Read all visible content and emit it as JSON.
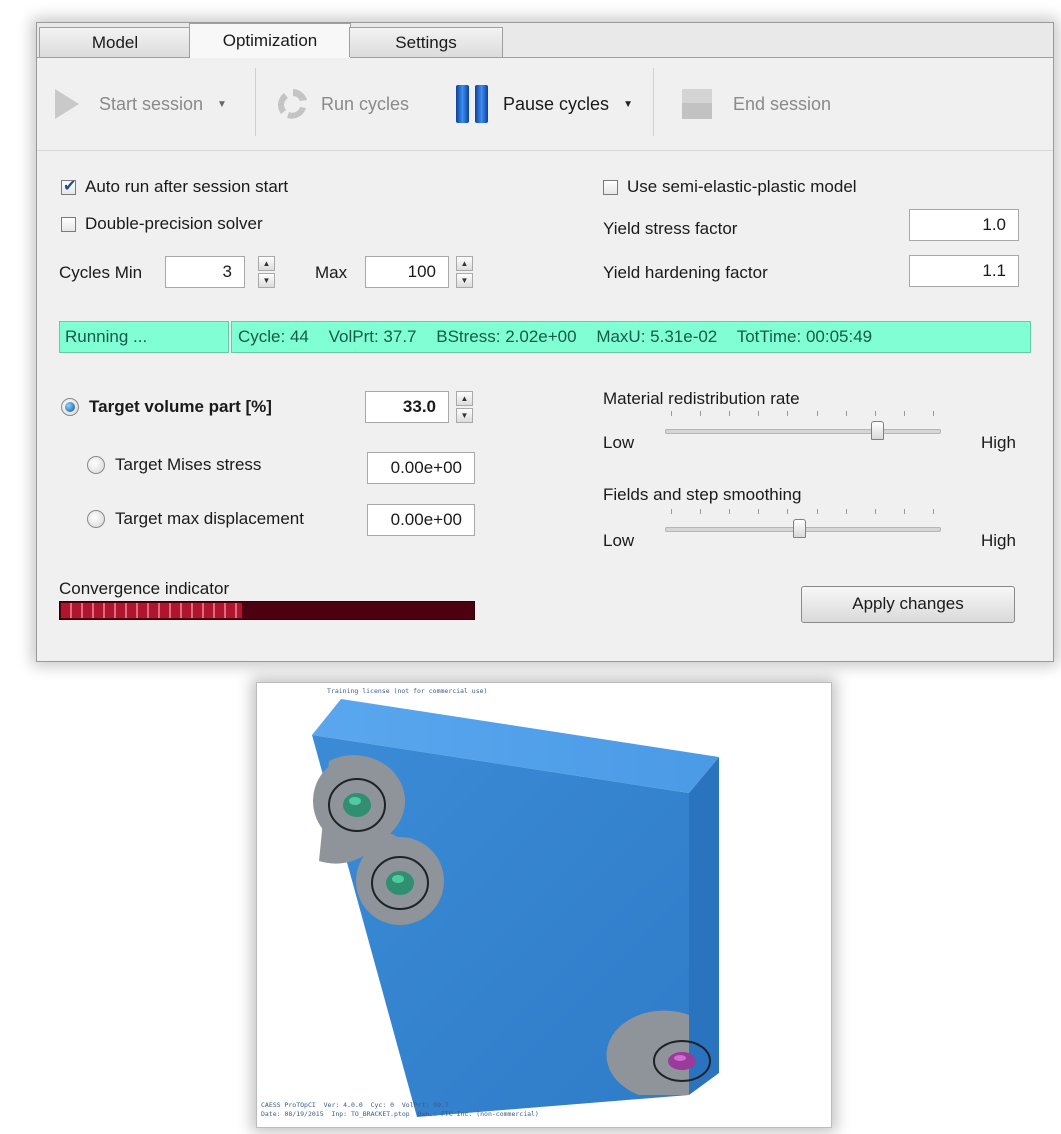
{
  "tabs": [
    "Model",
    "Optimization",
    "Settings"
  ],
  "toolbar": {
    "start_session": "Start session",
    "run_cycles": "Run cycles",
    "pause_cycles": "Pause cycles",
    "end_session": "End session"
  },
  "options": {
    "auto_run": {
      "label": "Auto run after session start",
      "checked": true
    },
    "double_precision": {
      "label": "Double-precision solver",
      "checked": false
    },
    "semi_elastic": {
      "label": "Use semi-elastic-plastic model",
      "checked": false
    }
  },
  "cycles": {
    "min_label": "Cycles Min",
    "min_value": "3",
    "max_label": "Max",
    "max_value": "100"
  },
  "yield": {
    "stress_label": "Yield stress factor",
    "stress_value": "1.0",
    "hardening_label": "Yield hardening factor",
    "hardening_value": "1.1"
  },
  "status": {
    "state": "Running ...",
    "cycle": "Cycle: 44",
    "volprt": "VolPrt: 37.7",
    "bstress": "BStress: 2.02e+00",
    "maxu": "MaxU: 5.31e-02",
    "tottime": "TotTime: 00:05:49"
  },
  "targets": {
    "volume": {
      "label": "Target volume part [%]",
      "value": "33.0",
      "selected": true
    },
    "mises": {
      "label": "Target Mises stress",
      "value": "0.00e+00",
      "selected": false
    },
    "displacement": {
      "label": "Target max displacement",
      "value": "0.00e+00",
      "selected": false
    }
  },
  "sliders": {
    "redistribution": {
      "label": "Material redistribution rate",
      "low": "Low",
      "high": "High",
      "level": 0.79
    },
    "smoothing": {
      "label": "Fields and step smoothing",
      "low": "Low",
      "high": "High",
      "level": 0.49
    }
  },
  "convergence": {
    "label": "Convergence indicator",
    "level": 0.44
  },
  "apply_label": "Apply changes",
  "viewport": {
    "license_text": "Training license (not for commercial use)",
    "footer_line1": "CAESS ProTOpCI  Ver: 4.0.0  Cyc: 0  VolPrt: 99.7",
    "footer_line2": "Date: 08/19/2015  Inp: TO_BRACKET.ptop  Own.: FTC Inc. (non-commercial)"
  },
  "colors": {
    "status_bg": "#80ffd4",
    "part_blue": "#3d8fd8",
    "convergence_bg": "#4c0010",
    "accent_pause": "#1e6fd0"
  }
}
